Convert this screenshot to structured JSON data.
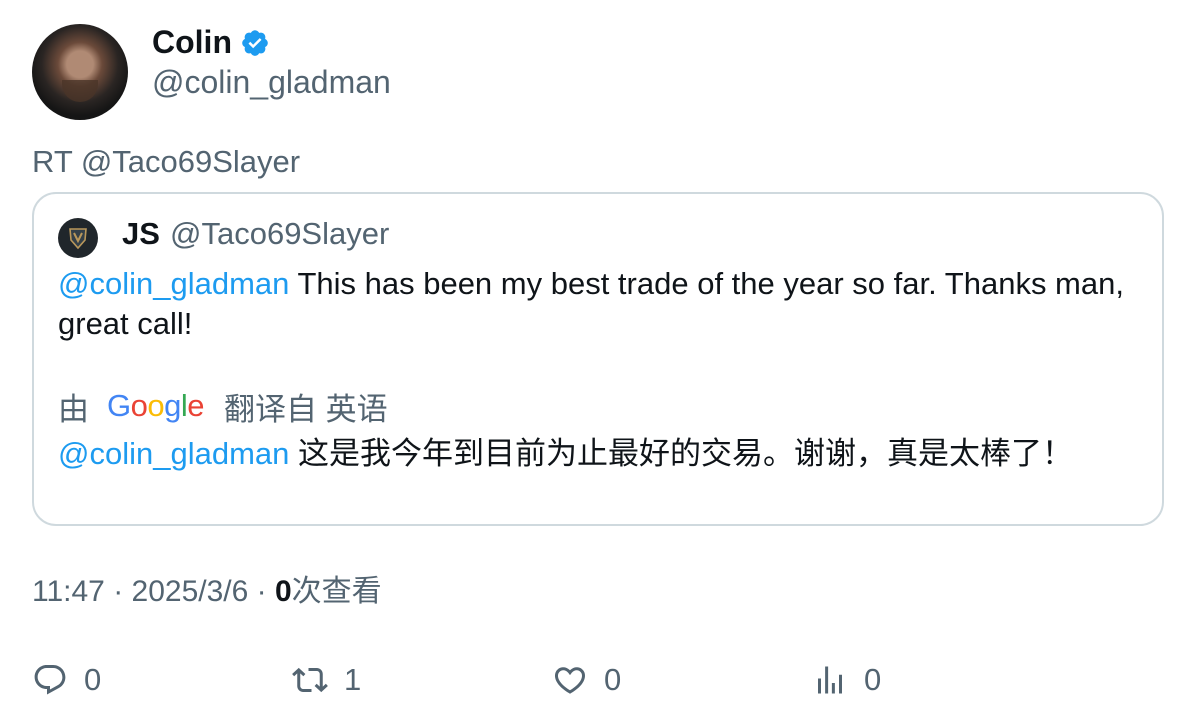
{
  "author": {
    "name": "Colin",
    "handle": "@colin_gladman",
    "verified_color": "#1d9bf0"
  },
  "retweet_label": "RT @Taco69Slayer",
  "quote": {
    "name": "JS",
    "handle": "@Taco69Slayer",
    "mention": "@colin_gladman",
    "text": " This has been my best trade of the year so far. Thanks man, great call!",
    "translation": {
      "by_label": "由",
      "provider": [
        "G",
        "o",
        "o",
        "g",
        "l",
        "e"
      ],
      "from_label": "翻译自 英语",
      "mention": "@colin_gladman",
      "text": " 这是我今年到目前为止最好的交易。谢谢，真是太棒了！"
    }
  },
  "meta": {
    "time": "11:47",
    "date": "2025/3/6",
    "views_count": "0",
    "views_label": "次查看"
  },
  "actions": {
    "reply_count": "0",
    "retweet_count": "1",
    "like_count": "0",
    "views_count": "0"
  },
  "colors": {
    "link": "#1d9bf0",
    "muted": "#536471",
    "border": "#cfd9de"
  }
}
